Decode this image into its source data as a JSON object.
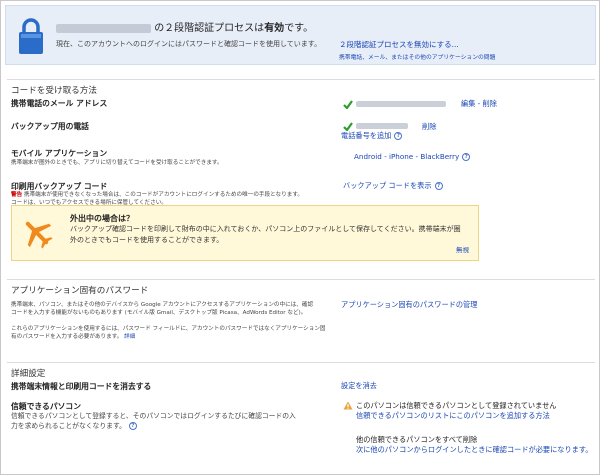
{
  "banner": {
    "status_before": "の２段階認証プロセスは",
    "status_bold": "有効",
    "status_after": "です。",
    "description": "現在、このアカウントへのログインにはパスワードと確認コードを使用しています。",
    "disable_link": "２段階認証プロセスを無効にする...",
    "disable_sub": "携帯電話、メール、またはその他のアプリケーションの問題"
  },
  "codes": {
    "section_title": "コードを受け取る方法",
    "sms_label": "携帯電話のメール アドレス",
    "sms_actions": "編集 - 削除",
    "backup_phone_label": "バックアップ用の電話",
    "backup_phone_delete": "削除",
    "add_phone": "電話番号を追加",
    "mobile_app_label": "モバイル アプリケーション",
    "mobile_app_desc": "携帯端末が圏外のときでも、アプリに切り替えてコードを受け取ることができます。",
    "mobile_app_links": "Android - iPhone - BlackBerry",
    "backup_codes_label": "印刷用バックアップ コード",
    "backup_codes_warn": "警告",
    "backup_codes_desc1": "携帯端末が使用できなくなった場合は、このコードがアカウントにログインするための唯一の手段となります。",
    "backup_codes_desc2": "コードは、いつでもアクセスできる場所に保管してください。",
    "show_backup_codes": "バックアップ コードを表示"
  },
  "travel": {
    "title": "外出中の場合は？",
    "text1": "バックアップ確認コードを印刷して財布の中に入れておくか、パソコン上のファイルとして保存してください。携帯端末が圏",
    "text2": "外のときでもコードを使用することができます。",
    "ignore": "無視"
  },
  "app_passwords": {
    "section_title": "アプリケーション固有のパスワード",
    "desc1": "携帯端末、パソコン、またはその他のデバイスから Google アカウントにアクセスするアプリケーションの中には、確認",
    "desc2": "コードを入力する機能がないものもあります (モバイル版 Gmail、デスクトップ版 Picasa、AdWords Editor など)。",
    "desc3": "これらのアプリケーションを使用するには、パスワード フィールドに、アカウントのパスワードではなくアプリケーション固",
    "desc4": "有のパスワードを入力する必要があります。",
    "details_link": "詳細",
    "manage_link": "アプリケーション固有のパスワードの管理"
  },
  "advanced": {
    "section_title": "詳細設定",
    "clear_label": "携帯端末情報と印刷用コードを消去する",
    "clear_link": "設定を消去",
    "trusted_label": "信頼できるパソコン",
    "trusted_desc1": "信頼できるパソコンとして登録すると、そのパソコンではログインするたびに確認コードの入",
    "trusted_desc2": "力を求められることがなくなります。",
    "not_trusted_text": "このパソコンは信頼できるパソコンとして登録されていません",
    "add_trusted_link": "信頼できるパソコンのリストにこのパソコンを追加する方法",
    "remove_others_text": "他の信頼できるパソコンをすべて削除",
    "remove_others_link": "次に他のパソコンからログインしたときに確認コードが必要になります。"
  },
  "colors": {
    "link": "#1a46b5",
    "banner_bg": "#e8eef8",
    "travel_bg": "#fff8d9",
    "check": "#2e9d2e",
    "warn_icon": "#e8a33a"
  }
}
